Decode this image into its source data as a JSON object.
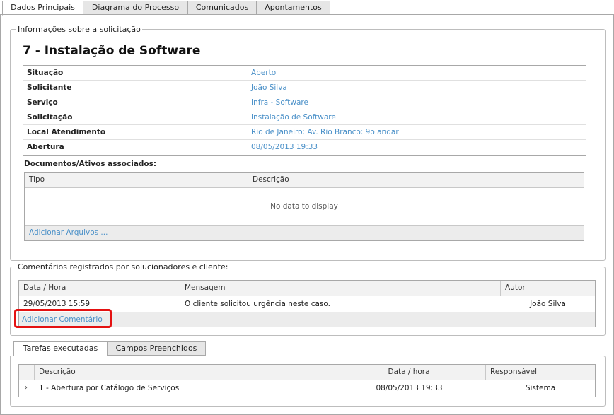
{
  "tabs": [
    "Dados Principais",
    "Diagrama do Processo",
    "Comunicados",
    "Apontamentos"
  ],
  "info_section": {
    "legend": "Informações sobre a solicitação",
    "title": "7 - Instalação de Software",
    "fields": [
      {
        "label": "Situação",
        "value": "Aberto"
      },
      {
        "label": "Solicitante",
        "value": "João Silva"
      },
      {
        "label": "Serviço",
        "value": "Infra - Software"
      },
      {
        "label": "Solicitação",
        "value": "Instalação de Software"
      },
      {
        "label": "Local Atendimento",
        "value": "Rio de Janeiro: Av. Rio Branco: 9o andar"
      },
      {
        "label": "Abertura",
        "value": "08/05/2013 19:33"
      }
    ]
  },
  "documents": {
    "heading": "Documentos/Ativos associados:",
    "columns": [
      "Tipo",
      "Descrição"
    ],
    "empty_text": "No data to display",
    "add_link": "Adicionar Arquivos ..."
  },
  "comments": {
    "legend": "Comentários registrados por solucionadores e cliente:",
    "columns": [
      "Data / Hora",
      "Mensagem",
      "Autor"
    ],
    "rows": [
      {
        "datetime": "29/05/2013 15:59",
        "message": "O cliente solicitou urgência neste caso.",
        "author": "João Silva"
      }
    ],
    "add_link": "Adicionar Comentário"
  },
  "bottom_tabs": [
    "Tarefas executadas",
    "Campos Preenchidos"
  ],
  "tasks": {
    "columns": [
      "Descrição",
      "Data / hora",
      "Responsável"
    ],
    "rows": [
      {
        "expander": "›",
        "description": "1 - Abertura por Catálogo de Serviços",
        "datetime": "08/05/2013 19:33",
        "responsible": "Sistema"
      }
    ]
  }
}
